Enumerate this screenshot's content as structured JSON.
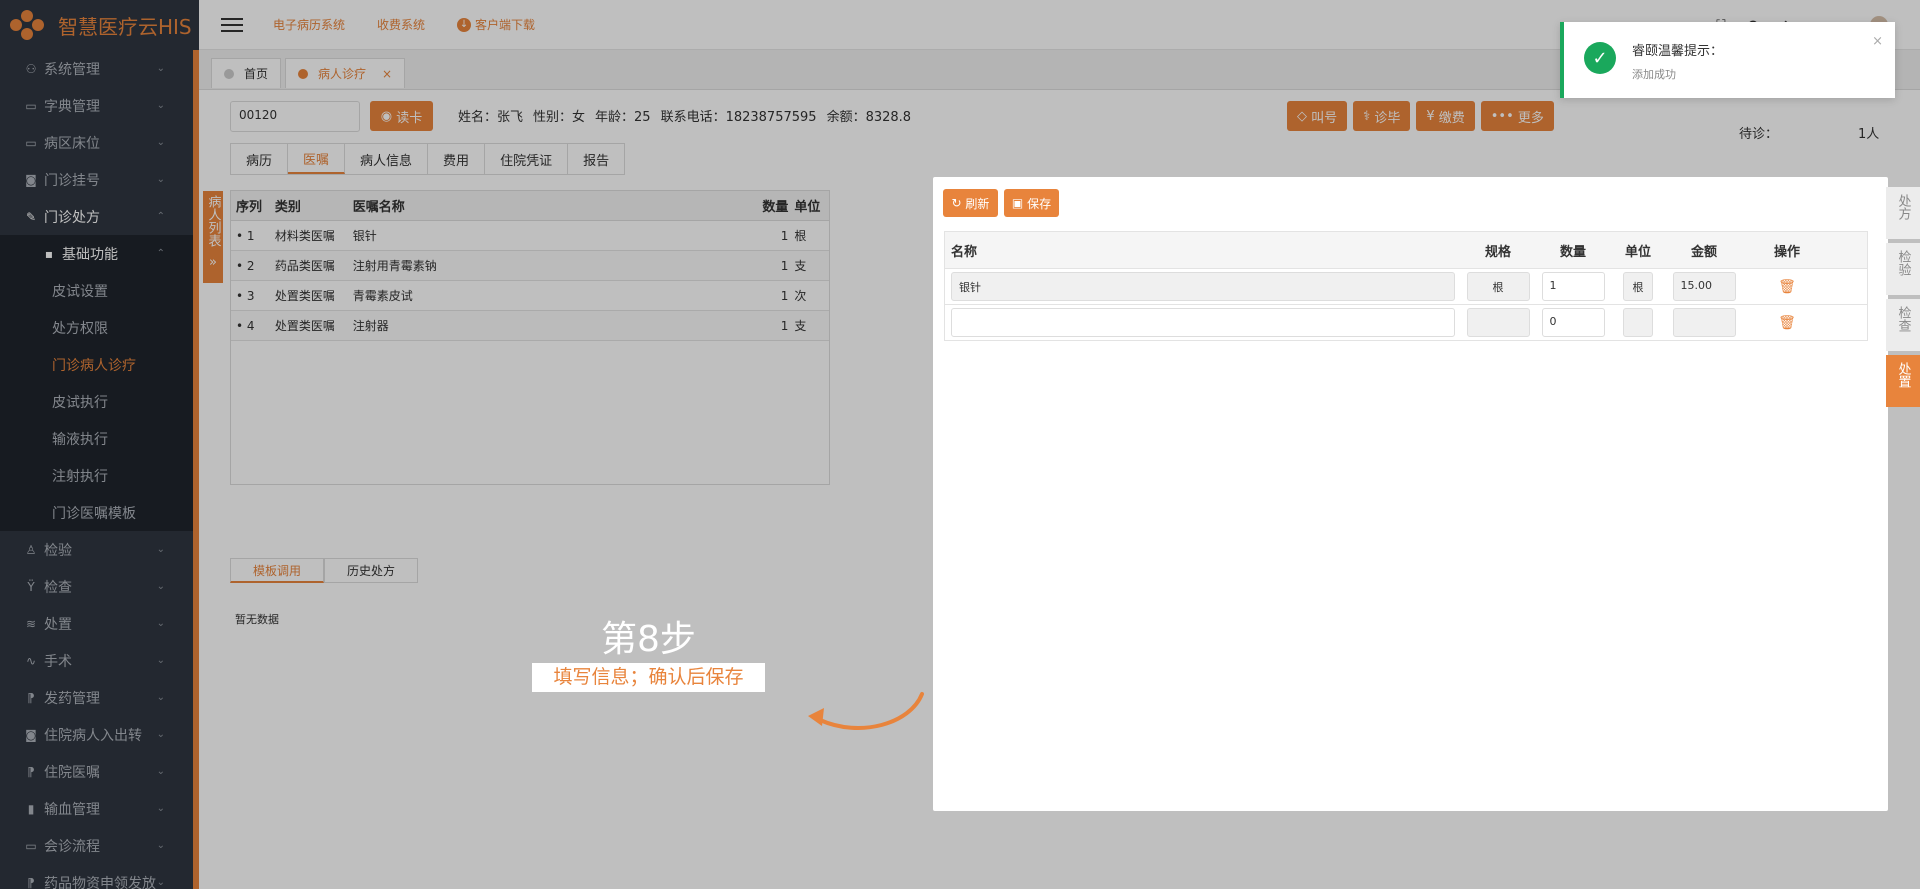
{
  "app": {
    "title": "智慧医疗云HIS"
  },
  "sidebar": {
    "items": [
      {
        "label": "系统管理",
        "icon": "users-icon"
      },
      {
        "label": "字典管理",
        "icon": "book-icon"
      },
      {
        "label": "病区床位",
        "icon": "folder-icon"
      },
      {
        "label": "门诊挂号",
        "icon": "camera-icon"
      },
      {
        "label": "门诊处方",
        "icon": "edit-icon"
      },
      {
        "label": "基础功能"
      },
      {
        "label": "皮试设置"
      },
      {
        "label": "处方权限"
      },
      {
        "label": "门诊病人诊疗"
      },
      {
        "label": "皮试执行"
      },
      {
        "label": "输液执行"
      },
      {
        "label": "注射执行"
      },
      {
        "label": "门诊医嘱模板"
      },
      {
        "label": "检验",
        "icon": "flask-icon"
      },
      {
        "label": "检查",
        "icon": "stethoscope-icon"
      },
      {
        "label": "处置",
        "icon": "layers-icon"
      },
      {
        "label": "手术",
        "icon": "pulse-icon"
      },
      {
        "label": "发药管理",
        "icon": "pill-icon"
      },
      {
        "label": "住院病人入出转",
        "icon": "camera-icon"
      },
      {
        "label": "住院医嘱",
        "icon": "pill-icon"
      },
      {
        "label": "输血管理",
        "icon": "blood-icon"
      },
      {
        "label": "会诊流程",
        "icon": "folder-icon"
      },
      {
        "label": "药品物资申领发放",
        "icon": "pill-icon"
      }
    ]
  },
  "topbar": {
    "links": [
      "电子病历系统",
      "收费系统",
      "客户端下载"
    ]
  },
  "page_tabs": [
    "首页",
    "病人诊疗"
  ],
  "patient": {
    "card_no": "00120",
    "read_card": "读卡",
    "name": "姓名：张飞",
    "gender": "性别：女",
    "age": "年龄：25",
    "phone": "联系电话：18238757595",
    "balance": "余额：8328.8"
  },
  "actions": [
    "叫号",
    "诊毕",
    "缴费",
    "更多"
  ],
  "subtabs": [
    "病历",
    "医嘱",
    "病人信息",
    "费用",
    "住院凭证",
    "报告"
  ],
  "waiting": {
    "label": "待诊：",
    "value": "1人"
  },
  "patient_list_tab": "病人列表",
  "orders": {
    "headers": [
      "序列",
      "类别",
      "医嘱名称",
      "数量",
      "单位"
    ],
    "rows": [
      {
        "seq": "• 1",
        "type": "材料类医嘱",
        "name": "银针",
        "qty": "1",
        "unit": "根"
      },
      {
        "seq": "• 2",
        "type": "药品类医嘱",
        "name": "注射用青霉素钠",
        "qty": "1",
        "unit": "支"
      },
      {
        "seq": "• 3",
        "type": "处置类医嘱",
        "name": "青霉素皮试",
        "qty": "1",
        "unit": "次"
      },
      {
        "seq": "• 4",
        "type": "处置类医嘱",
        "name": "注射器",
        "qty": "1",
        "unit": "支"
      }
    ]
  },
  "bottom_tabs": [
    "模板调用",
    "历史处方"
  ],
  "no_data": "暂无数据",
  "modal": {
    "refresh": "刷新",
    "save": "保存",
    "headers": [
      "名称",
      "规格",
      "数量",
      "单位",
      "金额",
      "操作"
    ],
    "rows": [
      {
        "name": "银针",
        "spec": "根",
        "qty": "1",
        "unit": "根",
        "amount": "15.00"
      },
      {
        "name": "",
        "spec": "",
        "qty": "0",
        "unit": "",
        "amount": ""
      }
    ]
  },
  "right_tabs": [
    "处方",
    "检验",
    "检查",
    "处置"
  ],
  "toast": {
    "title": "睿颐温馨提示：",
    "message": "添加成功"
  },
  "guide": {
    "step": "第8步",
    "desc": "填写信息；确认后保存"
  },
  "colors": {
    "accent": "#e8843c",
    "success": "#1aa85c",
    "sidebar": "#2f3640"
  }
}
